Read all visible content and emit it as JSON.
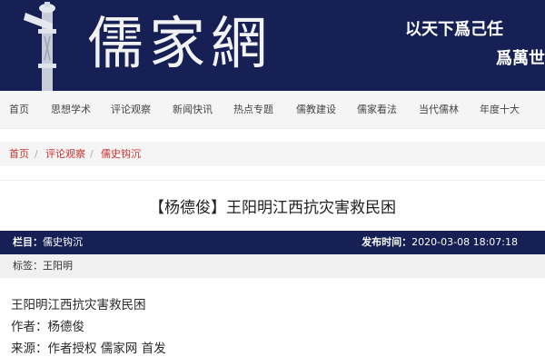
{
  "site": {
    "logo_text": "儒家網",
    "motto_line1": "以天下爲己任",
    "motto_line2": "爲萬世"
  },
  "nav": {
    "items": [
      {
        "label": "首页"
      },
      {
        "label": "思想学术"
      },
      {
        "label": "评论观察"
      },
      {
        "label": "新闻快讯"
      },
      {
        "label": "热点专题"
      },
      {
        "label": "儒教建设"
      },
      {
        "label": "儒家看法"
      },
      {
        "label": "当代儒林"
      },
      {
        "label": "年度十大"
      }
    ]
  },
  "breadcrumb": {
    "items": [
      {
        "label": "首页"
      },
      {
        "label": "评论观察"
      },
      {
        "label": "儒史钩沉"
      }
    ],
    "separator": "/"
  },
  "article": {
    "title": "【杨德俊】王阳明江西抗灾害救民困",
    "column_label": "栏目：",
    "column_value": "儒史钩沉",
    "published_label": "发布时间：",
    "published_value": "2020-03-08 18:07:18",
    "tags_label": "标签：",
    "tags_value": "王阳明",
    "body_lines": [
      "王阳明江西抗灾害救民困",
      "作者：杨德俊",
      "来源：作者授权 儒家网 首发"
    ]
  },
  "colors": {
    "banner_bg": "#162055",
    "accent_red": "#c9302c"
  }
}
